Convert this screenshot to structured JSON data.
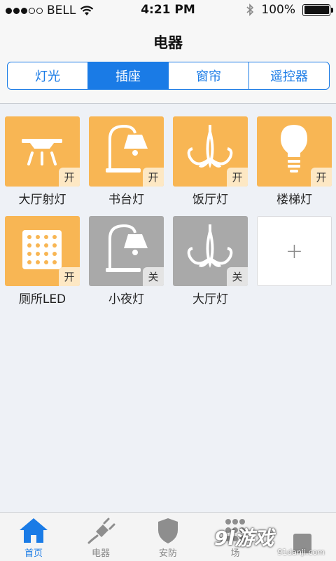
{
  "status_bar": {
    "carrier": "BELL",
    "time": "4:21 PM",
    "battery": "100%"
  },
  "header": {
    "title": "电器"
  },
  "segments": [
    {
      "label": "灯光",
      "active": false
    },
    {
      "label": "插座",
      "active": true
    },
    {
      "label": "窗帘",
      "active": false
    },
    {
      "label": "遥控器",
      "active": false
    }
  ],
  "devices": [
    {
      "label": "大厅射灯",
      "state": "开",
      "icon": "spotlight-icon",
      "on": true
    },
    {
      "label": "书台灯",
      "state": "开",
      "icon": "desk-lamp-icon",
      "on": true
    },
    {
      "label": "饭厅灯",
      "state": "开",
      "icon": "chandelier-icon",
      "on": true
    },
    {
      "label": "楼梯灯",
      "state": "开",
      "icon": "light-bulb-icon",
      "on": true
    },
    {
      "label": "厕所LED",
      "state": "开",
      "icon": "led-panel-icon",
      "on": true
    },
    {
      "label": "小夜灯",
      "state": "关",
      "icon": "desk-lamp-icon",
      "on": false
    },
    {
      "label": "大厅灯",
      "state": "关",
      "icon": "chandelier-icon",
      "on": false
    }
  ],
  "add_tile": {
    "label": "+"
  },
  "tabbar": [
    {
      "label": "首页",
      "icon": "home-icon",
      "active": true
    },
    {
      "label": "电器",
      "icon": "plug-icon",
      "active": false
    },
    {
      "label": "安防",
      "icon": "shield-icon",
      "active": false
    },
    {
      "label": "场",
      "icon": "scene-icon",
      "active": false
    },
    {
      "label": "",
      "icon": "settings-icon",
      "active": false
    }
  ],
  "watermark": {
    "logo": "9l游戏",
    "url": "91danji.com"
  },
  "colors": {
    "accent": "#1a7be6",
    "tile_on": "#f8b654",
    "tile_off": "#a9a9a9"
  }
}
